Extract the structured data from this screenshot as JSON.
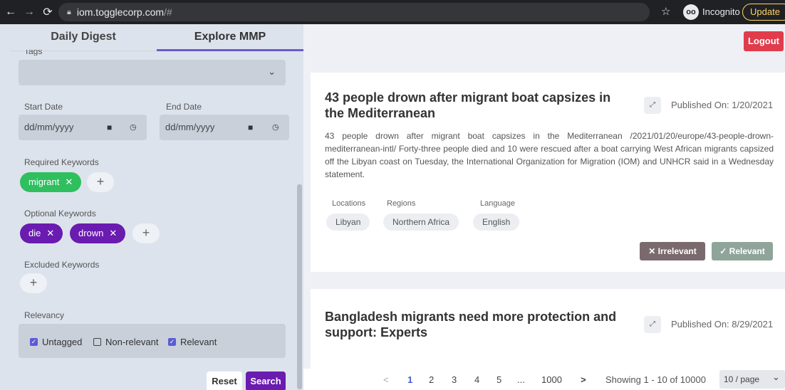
{
  "browser": {
    "url_host": "iom.togglecorp.com",
    "url_path": "/#",
    "incognito_label": "Incognito",
    "update_label": "Update"
  },
  "sidebar": {
    "tabs": [
      {
        "label": "Daily Digest",
        "active": false
      },
      {
        "label": "Explore MMP",
        "active": true
      }
    ],
    "tags_label": "Tags",
    "start_date_label": "Start Date",
    "end_date_label": "End Date",
    "start_date_placeholder": "dd/mm/yyyy",
    "end_date_placeholder": "dd/mm/yyyy",
    "required_keywords_label": "Required Keywords",
    "required_keywords": [
      "migrant"
    ],
    "optional_keywords_label": "Optional Keywords",
    "optional_keywords": [
      "die",
      "drown"
    ],
    "excluded_keywords_label": "Excluded Keywords",
    "relevancy_label": "Relevancy",
    "relevancy_options": [
      {
        "label": "Untagged",
        "checked": true
      },
      {
        "label": "Non-relevant",
        "checked": false
      },
      {
        "label": "Relevant",
        "checked": true
      }
    ],
    "reset_label": "Reset",
    "search_label": "Search"
  },
  "main": {
    "logout_label": "Logout",
    "articles": [
      {
        "title": "43 people drown after migrant boat capsizes in the Mediterranean",
        "published": "Published On:  1/20/2021",
        "body": "43 people drown after migrant boat capsizes in the Mediterranean /2021/01/20/europe/43-people-drown-mediterranean-intl/ Forty-three people died and 10 were rescued after a boat carrying West African migrants capsized off the Libyan coast on Tuesday, the International Organization for Migration (IOM) and UNHCR said in a Wednesday statement.",
        "locations_label": "Locations",
        "regions_label": "Regions",
        "language_label": "Language",
        "location": "Libyan",
        "region": "Northern Africa",
        "language": "English",
        "irrelevant_label": "Irrelevant",
        "relevant_label": "Relevant"
      },
      {
        "title": "Bangladesh migrants need more protection and support: Experts",
        "published": "Published On:  8/29/2021"
      }
    ]
  },
  "pagination": {
    "pages": [
      "1",
      "2",
      "3",
      "4",
      "5",
      "...",
      "1000"
    ],
    "showing": "Showing 1 - 10 of 10000",
    "page_size": "10 / page"
  }
}
